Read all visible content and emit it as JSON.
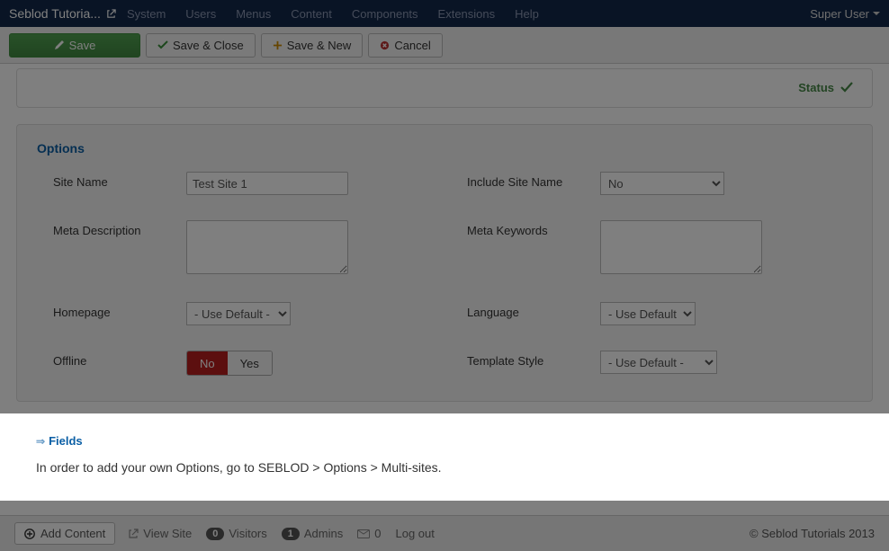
{
  "topbar": {
    "brand": "Seblod Tutoria...",
    "menu": [
      "System",
      "Users",
      "Menus",
      "Content",
      "Components",
      "Extensions",
      "Help"
    ],
    "user": "Super User"
  },
  "toolbar": {
    "save": "Save",
    "save_close": "Save & Close",
    "save_new": "Save & New",
    "cancel": "Cancel"
  },
  "status": {
    "label": "Status"
  },
  "options": {
    "title": "Options",
    "site_name": {
      "label": "Site Name",
      "value": "Test Site 1"
    },
    "include_site_name": {
      "label": "Include Site Name",
      "value": "No"
    },
    "meta_description": {
      "label": "Meta Description",
      "value": ""
    },
    "meta_keywords": {
      "label": "Meta Keywords",
      "value": ""
    },
    "homepage": {
      "label": "Homepage",
      "value": "- Use Default -"
    },
    "language": {
      "label": "Language",
      "value": "- Use Default -"
    },
    "offline": {
      "label": "Offline",
      "no": "No",
      "yes": "Yes"
    },
    "template_style": {
      "label": "Template Style",
      "value": "- Use Default -"
    }
  },
  "fields": {
    "link": "Fields",
    "note": "In order to add your own Options, go to SEBLOD > Options > Multi-sites."
  },
  "footer": {
    "add_content": "Add Content",
    "view_site": "View Site",
    "visitors_count": "0",
    "visitors": "Visitors",
    "admins_count": "1",
    "admins": "Admins",
    "messages_count": "0",
    "logout": "Log out",
    "copyright": "© Seblod Tutorials 2013"
  }
}
